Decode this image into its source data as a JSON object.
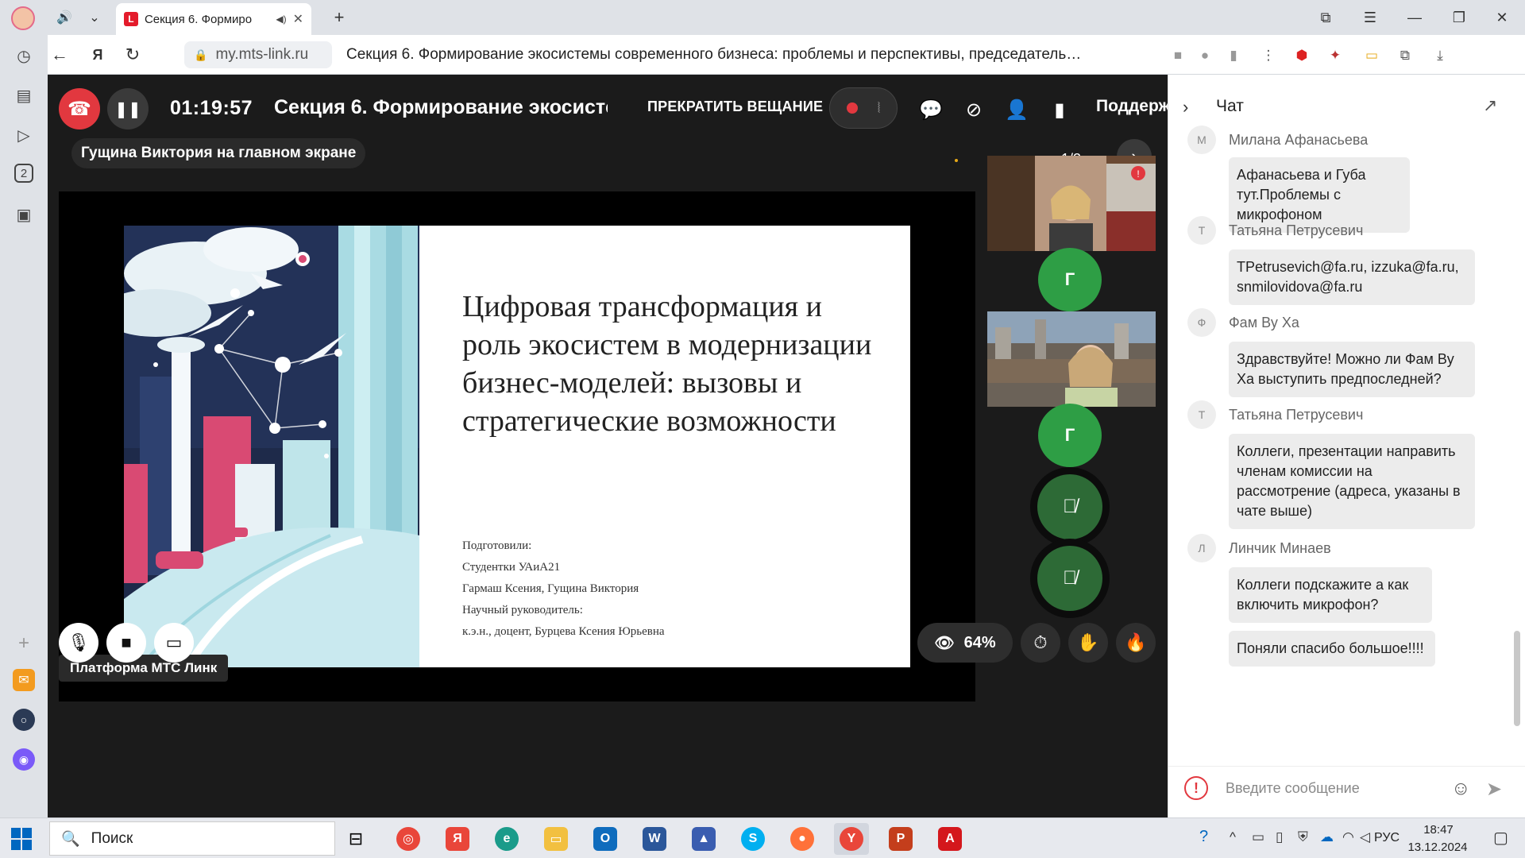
{
  "browser": {
    "tab_title": "Секция 6. Формиро",
    "url_domain": "my.mts-link.ru",
    "page_title": "Секция 6. Формирование экосистемы современного бизнеса: проблемы и перспективы, председатель…"
  },
  "call": {
    "timer": "01:19:57",
    "session_title": "Секция 6. Формирование экосисте",
    "stop_broadcast_label": "ПРЕКРАТИТЬ ВЕЩАНИЕ",
    "support_label": "Поддерж",
    "main_screen_label": "Гущина Виктория на главном экране",
    "page_counter": "1/3",
    "platform_label": "Платформа МТС Линк",
    "views_percent": "64%"
  },
  "slide": {
    "title": "Цифровая трансформация и роль экосистем в модернизации бизнес-моделей: вызовы и стратегические возможности",
    "credits": [
      "Подготовили:",
      "Студентки УАиА21",
      "Гармаш Ксения, Гущина Виктория",
      "Научный руководитель:",
      "к.э.н., доцент, Бурцева Ксения Юрьевна"
    ]
  },
  "participants": {
    "avatar_letter_1": "Г",
    "avatar_letter_2": "Г"
  },
  "chat": {
    "title": "Чат",
    "input_placeholder": "Введите сообщение",
    "messages": [
      {
        "initial": "М",
        "author": "Милана Афанасьева",
        "bubbles": [
          "Афанасьева и Губа тут.Проблемы с микрофоном"
        ]
      },
      {
        "initial": "Т",
        "author": "Татьяна Петрусевич",
        "bubbles": [
          "TPetrusevich@fa.ru, izzuka@fa.ru, snmilovidova@fa.ru"
        ]
      },
      {
        "initial": "Ф",
        "author": "Фам Ву Ха",
        "bubbles": [
          "Здравствуйте! Можно ли Фам Ву Ха выступить предпоследней?"
        ]
      },
      {
        "initial": "Т",
        "author": "Татьяна Петрусевич",
        "bubbles": [
          "Коллеги, презентации направить членам комиссии на рассмотрение (адреса, указаны в чате  выше)"
        ]
      },
      {
        "initial": "Л",
        "author": "Линчик Минаев",
        "bubbles": [
          "Коллеги подскажите а как включить микрофон?",
          "Поняли спасибо большое!!!!"
        ]
      }
    ]
  },
  "taskbar": {
    "search_label": "Поиск",
    "language": "РУС",
    "time": "18:47",
    "date": "13.12.2024"
  },
  "colors": {
    "hangup": "#e2383f",
    "avatar_green": "#2e9e45",
    "mic_off_green": "#2d6a36",
    "chat_bubble": "#ececec"
  }
}
